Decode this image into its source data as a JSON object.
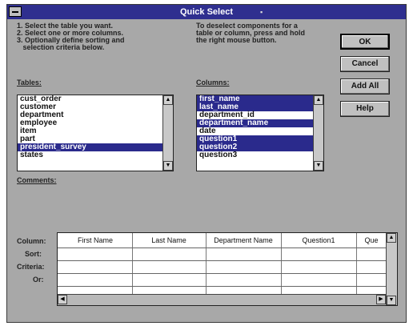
{
  "window": {
    "title": "Quick Select"
  },
  "instructions": {
    "left": "1. Select the table you want.\n2. Select one or more columns.\n3. Optionally define sorting and\n   selection criteria below.",
    "right": "To deselect components for a\ntable or column, press and hold\nthe right mouse button."
  },
  "tables": {
    "label": "Tables:",
    "items": [
      {
        "label": "cust_order",
        "selected": false
      },
      {
        "label": "customer",
        "selected": false
      },
      {
        "label": "department",
        "selected": false
      },
      {
        "label": "employee",
        "selected": false
      },
      {
        "label": "item",
        "selected": false
      },
      {
        "label": "part",
        "selected": false
      },
      {
        "label": "president_survey",
        "selected": true
      },
      {
        "label": "states",
        "selected": false
      }
    ]
  },
  "columns": {
    "label": "Columns:",
    "items": [
      {
        "label": "first_name",
        "selected": true
      },
      {
        "label": "last_name",
        "selected": true
      },
      {
        "label": "department_id",
        "selected": false
      },
      {
        "label": "department_name",
        "selected": true
      },
      {
        "label": "date",
        "selected": false
      },
      {
        "label": "question1",
        "selected": true
      },
      {
        "label": "question2",
        "selected": true
      },
      {
        "label": "question3",
        "selected": false
      }
    ]
  },
  "comments_label": "Comments:",
  "buttons": {
    "ok": "OK",
    "cancel": "Cancel",
    "add_all": "Add All",
    "help": "Help"
  },
  "grid": {
    "row_labels": [
      "Column:",
      "Sort:",
      "Criteria:",
      "Or:"
    ],
    "headers": [
      "First Name",
      "Last Name",
      "Department Name",
      "Question1",
      "Que"
    ]
  }
}
